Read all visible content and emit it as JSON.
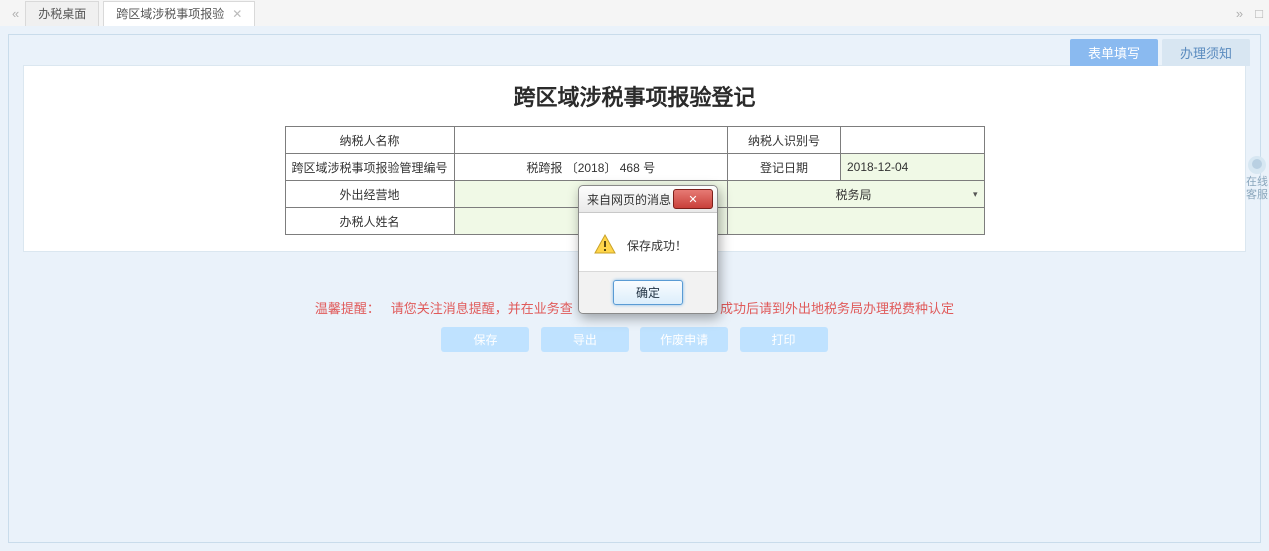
{
  "tabs": {
    "tab0": "办税桌面",
    "tab1": "跨区域涉税事项报验"
  },
  "sub_tabs": {
    "active": "表单填写",
    "inactive": "办理须知"
  },
  "title": "跨区域涉税事项报验登记",
  "form": {
    "r1": {
      "taxpayer_name_lbl": "纳税人名称",
      "taxpayer_name_val": "",
      "taxpayer_id_lbl": "纳税人识别号",
      "taxpayer_id_val": ""
    },
    "r2": {
      "mgmt_no_lbl": "跨区域涉税事项报验管理编号",
      "mgmt_no_val": "税跨报 〔2018〕 468 号",
      "reg_date_lbl": "登记日期",
      "reg_date_val": "2018-12-04"
    },
    "r3": {
      "out_place_lbl": "外出经营地",
      "out_place_val": "",
      "tax_bureau_val": "税务局"
    },
    "r4": {
      "handler_name_lbl": "办税人姓名",
      "handler_name_val": ""
    }
  },
  "tip": {
    "prefix": "温馨提醒：",
    "left": "请您关注消息提醒，并在业务查",
    "right": "成功后请到外出地税务局办理税费种认定"
  },
  "buttons": {
    "b1": "保存",
    "b2": "导出",
    "b3": "作废申请",
    "b4": "打印"
  },
  "modal": {
    "title": "来自网页的消息",
    "body": "保存成功！",
    "ok": "确定"
  },
  "side_widget": "在线客服"
}
